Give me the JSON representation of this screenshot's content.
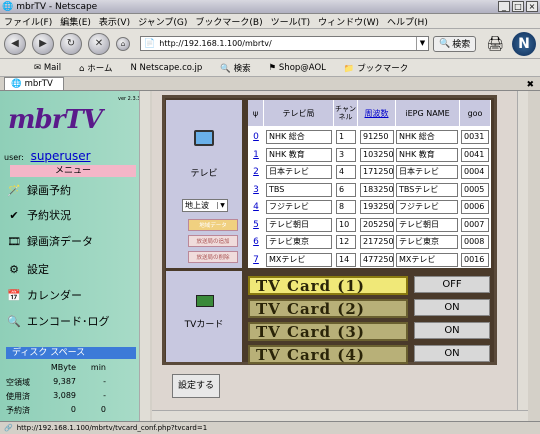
{
  "window": {
    "title": "mbrTV - Netscape"
  },
  "menubar": [
    "ファイル(F)",
    "編集(E)",
    "表示(V)",
    "ジャンプ(G)",
    "ブックマーク(B)",
    "ツール(T)",
    "ウィンドウ(W)",
    "ヘルプ(H)"
  ],
  "nav": {
    "url": "http://192.168.1.100/mbrtv/",
    "search_label": "検索"
  },
  "bookmarks": [
    "Mail",
    "ホーム",
    "Netscape.co.jp",
    "検索",
    "Shop@AOL",
    "ブックマーク"
  ],
  "tab": {
    "label": "mbrTV"
  },
  "sidebar": {
    "version": "ver 2.3.3",
    "logo": "mbrTV",
    "user_label": "user:",
    "user_name": "superuser",
    "menu_header": "メニュー",
    "items": [
      {
        "label": "録画予約",
        "icon": "magic-wand-icon"
      },
      {
        "label": "予約状況",
        "icon": "check-icon"
      },
      {
        "label": "録画済データ",
        "icon": "film-icon"
      },
      {
        "label": "設定",
        "icon": "gear-icon"
      },
      {
        "label": "カレンダー",
        "icon": "calendar-icon"
      },
      {
        "label": "エンコード･ログ",
        "icon": "magnifier-icon"
      }
    ],
    "disk_header": "ディスク スペース",
    "disk_cols": [
      "",
      "MByte",
      "min"
    ],
    "disk_rows": [
      [
        "空領域",
        "9,387",
        "-"
      ],
      [
        "使用済",
        "3,089",
        "-"
      ],
      [
        "予約済",
        "0",
        "0"
      ]
    ]
  },
  "tv_panel": {
    "tv_label": "テレビ",
    "select_value": "地上波",
    "buttons": [
      "地域データ",
      "放送局の追加",
      "放送局の削除"
    ],
    "card_label": "TVカード",
    "setup_button": "設定する"
  },
  "channel_table": {
    "headers": [
      "ψ",
      "テレビ局",
      "チャンネル",
      "周波数",
      "iEPG NAME",
      "goo"
    ],
    "rows": [
      [
        "0",
        "NHK 総合",
        "1",
        "91250",
        "NHK 総合",
        "0031"
      ],
      [
        "1",
        "NHK 教育",
        "3",
        "103250",
        "NHK 教育",
        "0041"
      ],
      [
        "2",
        "日本テレビ",
        "4",
        "171250",
        "日本テレビ",
        "0004"
      ],
      [
        "3",
        "TBS",
        "6",
        "183250",
        "TBSテレビ",
        "0005"
      ],
      [
        "4",
        "フジテレビ",
        "8",
        "193250",
        "フジテレビ",
        "0006"
      ],
      [
        "5",
        "テレビ朝日",
        "10",
        "205250",
        "テレビ朝日",
        "0007"
      ],
      [
        "6",
        "テレビ東京",
        "12",
        "217250",
        "テレビ東京",
        "0008"
      ],
      [
        "7",
        "MXテレビ",
        "14",
        "477250",
        "MXテレビ",
        "0016"
      ]
    ]
  },
  "cards": [
    {
      "label": "TV Card (1)",
      "state": "OFF"
    },
    {
      "label": "TV Card (2)",
      "state": "ON"
    },
    {
      "label": "TV Card (3)",
      "state": "ON"
    },
    {
      "label": "TV Card (4)",
      "state": "ON"
    }
  ],
  "status": {
    "text": "http://192.168.1.100/mbrtv/tvcard_conf.php?tvcard=1"
  }
}
